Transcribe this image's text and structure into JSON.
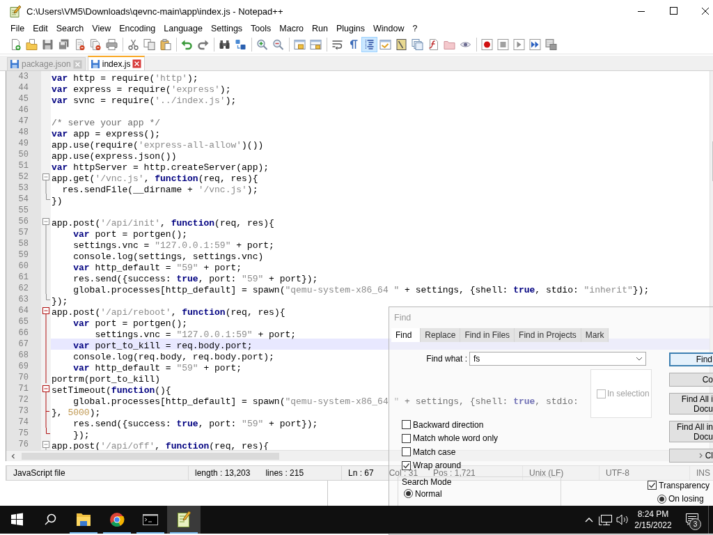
{
  "window": {
    "title": "C:\\Users\\VM5\\Downloads\\qevnc-main\\app\\index.js - Notepad++"
  },
  "menu": [
    "File",
    "Edit",
    "Search",
    "View",
    "Encoding",
    "Language",
    "Settings",
    "Tools",
    "Macro",
    "Run",
    "Plugins",
    "Window",
    "?"
  ],
  "toolbar": [
    [
      {
        "kind": "new",
        "pressed": false
      },
      {
        "kind": "open",
        "pressed": false
      },
      {
        "kind": "save",
        "pressed": false
      },
      {
        "kind": "save_all",
        "pressed": false
      },
      {
        "kind": "close",
        "pressed": false
      },
      {
        "kind": "close_all",
        "pressed": false
      },
      {
        "kind": "print",
        "pressed": false
      }
    ],
    [
      {
        "kind": "cut",
        "pressed": false
      },
      {
        "kind": "copy",
        "pressed": false
      },
      {
        "kind": "paste",
        "pressed": false
      }
    ],
    [
      {
        "kind": "undo",
        "pressed": false
      },
      {
        "kind": "redo",
        "pressed": false
      }
    ],
    [
      {
        "kind": "find",
        "pressed": false
      },
      {
        "kind": "replace",
        "pressed": false
      }
    ],
    [
      {
        "kind": "zoom_in",
        "pressed": false
      },
      {
        "kind": "zoom_out",
        "pressed": false
      }
    ],
    [
      {
        "kind": "sync_v",
        "pressed": false
      },
      {
        "kind": "sync_h",
        "pressed": false
      }
    ],
    [
      {
        "kind": "wrap",
        "pressed": false
      },
      {
        "kind": "all_chars",
        "pressed": false
      },
      {
        "kind": "indent_guide",
        "pressed": true
      },
      {
        "kind": "udl",
        "pressed": false
      },
      {
        "kind": "doc_map",
        "pressed": false
      },
      {
        "kind": "doc_list",
        "pressed": false
      },
      {
        "kind": "func_list",
        "pressed": false
      },
      {
        "kind": "workspace",
        "pressed": false
      },
      {
        "kind": "monitor",
        "pressed": false
      }
    ],
    [
      {
        "kind": "record",
        "pressed": false
      },
      {
        "kind": "stop",
        "pressed": false
      },
      {
        "kind": "play",
        "pressed": false
      },
      {
        "kind": "play_multi",
        "pressed": false
      },
      {
        "kind": "save_macro",
        "pressed": false
      }
    ]
  ],
  "tabs": [
    {
      "label": "package.json",
      "selected": false
    },
    {
      "label": "index.js",
      "selected": true
    }
  ],
  "editor": {
    "lines": [
      {
        "number": "43",
        "selected": false,
        "tokens": [
          {
            "kind": "keyword",
            "text": "var"
          },
          {
            "kind": "plain",
            "text": " http = require("
          },
          {
            "kind": "string",
            "text": "'http'"
          },
          {
            "kind": "plain",
            "text": ");"
          }
        ]
      },
      {
        "number": "44",
        "selected": false,
        "tokens": [
          {
            "kind": "keyword",
            "text": "var"
          },
          {
            "kind": "plain",
            "text": " express = require("
          },
          {
            "kind": "string",
            "text": "'express'"
          },
          {
            "kind": "plain",
            "text": ");"
          }
        ]
      },
      {
        "number": "45",
        "selected": false,
        "tokens": [
          {
            "kind": "keyword",
            "text": "var"
          },
          {
            "kind": "plain",
            "text": " svnc = require("
          },
          {
            "kind": "string",
            "text": "'../index.js'"
          },
          {
            "kind": "plain",
            "text": ");"
          }
        ]
      },
      {
        "number": "46",
        "selected": false
      },
      {
        "number": "47",
        "selected": false,
        "tokens": [
          {
            "kind": "comment",
            "text": "/* serve your app */"
          }
        ]
      },
      {
        "number": "48",
        "selected": false,
        "tokens": [
          {
            "kind": "keyword",
            "text": "var"
          },
          {
            "kind": "plain",
            "text": " app = express();"
          }
        ]
      },
      {
        "number": "49",
        "selected": false,
        "tokens": [
          {
            "kind": "plain",
            "text": "app.use(require("
          },
          {
            "kind": "string",
            "text": "'express-all-allow'"
          },
          {
            "kind": "plain",
            "text": ")())"
          }
        ]
      },
      {
        "number": "50",
        "selected": false,
        "tokens": [
          {
            "kind": "plain",
            "text": "app.use(express.json())"
          }
        ]
      },
      {
        "number": "51",
        "selected": false,
        "tokens": [
          {
            "kind": "keyword",
            "text": "var"
          },
          {
            "kind": "plain",
            "text": " httpServer = http.createServer(app);"
          }
        ]
      },
      {
        "number": "52",
        "fold": {
          "kind": "open",
          "highlight": false
        },
        "selected": false,
        "tokens": [
          {
            "kind": "plain",
            "text": "app.get("
          },
          {
            "kind": "string",
            "text": "'/vnc.js'"
          },
          {
            "kind": "plain",
            "text": ", "
          },
          {
            "kind": "keyword",
            "text": "function"
          },
          {
            "kind": "plain",
            "text": "(req, res){"
          }
        ]
      },
      {
        "number": "53",
        "fold": {
          "kind": "body",
          "highlight": false
        },
        "selected": false,
        "tokens": [
          {
            "kind": "plain",
            "text": "  res.sendFile(__dirname + "
          },
          {
            "kind": "string",
            "text": "'/vnc.js'"
          },
          {
            "kind": "plain",
            "text": ");"
          }
        ]
      },
      {
        "number": "54",
        "fold": {
          "kind": "close",
          "highlight": false
        },
        "selected": false,
        "tokens": [
          {
            "kind": "plain",
            "text": "})"
          }
        ]
      },
      {
        "number": "55",
        "selected": false
      },
      {
        "number": "56",
        "fold": {
          "kind": "open",
          "highlight": false
        },
        "selected": false,
        "tokens": [
          {
            "kind": "plain",
            "text": "app.post("
          },
          {
            "kind": "string",
            "text": "'/api/init'"
          },
          {
            "kind": "plain",
            "text": ", "
          },
          {
            "kind": "keyword",
            "text": "function"
          },
          {
            "kind": "plain",
            "text": "(req, res){"
          }
        ]
      },
      {
        "number": "57",
        "fold": {
          "kind": "body",
          "highlight": false
        },
        "selected": false,
        "tokens": [
          {
            "kind": "keyword",
            "text": "    var"
          },
          {
            "kind": "plain",
            "text": " port = portgen();"
          }
        ]
      },
      {
        "number": "58",
        "fold": {
          "kind": "body",
          "highlight": false
        },
        "selected": false,
        "tokens": [
          {
            "kind": "plain",
            "text": "    settings.vnc = "
          },
          {
            "kind": "string",
            "text": "\"127.0.0.1:59\""
          },
          {
            "kind": "plain",
            "text": " + port;"
          }
        ]
      },
      {
        "number": "59",
        "fold": {
          "kind": "body",
          "highlight": false
        },
        "selected": false,
        "tokens": [
          {
            "kind": "plain",
            "text": "    console.log(settings, settings.vnc)"
          }
        ]
      },
      {
        "number": "60",
        "fold": {
          "kind": "body",
          "highlight": false
        },
        "selected": false,
        "tokens": [
          {
            "kind": "keyword",
            "text": "    var"
          },
          {
            "kind": "plain",
            "text": " http_default = "
          },
          {
            "kind": "string",
            "text": "\"59\""
          },
          {
            "kind": "plain",
            "text": " + port;"
          }
        ]
      },
      {
        "number": "61",
        "fold": {
          "kind": "body",
          "highlight": false
        },
        "selected": false,
        "tokens": [
          {
            "kind": "plain",
            "text": "    res.send({success: "
          },
          {
            "kind": "keyword",
            "text": "true"
          },
          {
            "kind": "plain",
            "text": ", port: "
          },
          {
            "kind": "string",
            "text": "\"59\""
          },
          {
            "kind": "plain",
            "text": " + port});"
          }
        ]
      },
      {
        "number": "62",
        "fold": {
          "kind": "body",
          "highlight": false
        },
        "selected": false,
        "tokens": [
          {
            "kind": "plain",
            "text": "    global.processes[http_default] = spawn("
          },
          {
            "kind": "string",
            "text": "\"qemu-system-x86_64 \""
          },
          {
            "kind": "plain",
            "text": " + settings, {shell: "
          },
          {
            "kind": "keyword",
            "text": "true"
          },
          {
            "kind": "plain",
            "text": ", stdio: "
          },
          {
            "kind": "string",
            "text": "\"inherit\""
          },
          {
            "kind": "plain",
            "text": "});"
          }
        ]
      },
      {
        "number": "63",
        "fold": {
          "kind": "close",
          "highlight": false
        },
        "selected": false,
        "tokens": [
          {
            "kind": "plain",
            "text": "});"
          }
        ]
      },
      {
        "number": "64",
        "fold": {
          "kind": "open",
          "highlight": true
        },
        "selected": false,
        "tokens": [
          {
            "kind": "plain",
            "text": "app.post("
          },
          {
            "kind": "string",
            "text": "'/api/reboot'"
          },
          {
            "kind": "plain",
            "text": ", "
          },
          {
            "kind": "keyword",
            "text": "function"
          },
          {
            "kind": "plain",
            "text": "(req, res){"
          }
        ]
      },
      {
        "number": "65",
        "fold": {
          "kind": "body",
          "highlight": true
        },
        "selected": false,
        "tokens": [
          {
            "kind": "keyword",
            "text": "    var"
          },
          {
            "kind": "plain",
            "text": " port = portgen();"
          }
        ]
      },
      {
        "number": "66",
        "fold": {
          "kind": "body",
          "highlight": true
        },
        "selected": false,
        "tokens": [
          {
            "kind": "plain",
            "text": "        settings.vnc = "
          },
          {
            "kind": "string",
            "text": "\"127.0.0.1:59\""
          },
          {
            "kind": "plain",
            "text": " + port;"
          }
        ]
      },
      {
        "number": "67",
        "fold": {
          "kind": "body",
          "highlight": true
        },
        "selected": true,
        "tokens": [
          {
            "kind": "keyword",
            "text": "    var"
          },
          {
            "kind": "plain",
            "text": " port_to_kill = req.body.port;"
          }
        ]
      },
      {
        "number": "68",
        "fold": {
          "kind": "body",
          "highlight": true
        },
        "selected": false,
        "tokens": [
          {
            "kind": "plain",
            "text": "    console.log(req.body, req.body.port);"
          }
        ]
      },
      {
        "number": "69",
        "fold": {
          "kind": "body",
          "highlight": true
        },
        "selected": false,
        "tokens": [
          {
            "kind": "keyword",
            "text": "    var"
          },
          {
            "kind": "plain",
            "text": " http_default = "
          },
          {
            "kind": "string",
            "text": "\"59\""
          },
          {
            "kind": "plain",
            "text": " + port;"
          }
        ]
      },
      {
        "number": "70",
        "fold": {
          "kind": "body",
          "highlight": true
        },
        "selected": false,
        "tokens": [
          {
            "kind": "plain",
            "text": "portrm(port_to_kill)"
          }
        ]
      },
      {
        "number": "71",
        "fold": {
          "kind": "open",
          "highlight": true
        },
        "selected": false,
        "tokens": [
          {
            "kind": "plain",
            "text": "setTimeout("
          },
          {
            "kind": "keyword",
            "text": "function"
          },
          {
            "kind": "plain",
            "text": "(){"
          }
        ]
      },
      {
        "number": "72",
        "fold": {
          "kind": "body",
          "highlight": true
        },
        "selected": false,
        "tokens": [
          {
            "kind": "plain",
            "text": "    global.processes[http_default] = spawn("
          },
          {
            "kind": "string",
            "text": "\"qemu-system-x86_64 \""
          },
          {
            "kind": "plain",
            "text": " + settings, {shell: "
          },
          {
            "kind": "keyword",
            "text": "true"
          },
          {
            "kind": "plain",
            "text": ", stdio:"
          }
        ]
      },
      {
        "number": "73",
        "fold": {
          "kind": "branch",
          "highlight": true
        },
        "selected": false,
        "tokens": [
          {
            "kind": "plain",
            "text": "}, "
          },
          {
            "kind": "number",
            "text": "5000"
          },
          {
            "kind": "plain",
            "text": ");"
          }
        ]
      },
      {
        "number": "74",
        "fold": {
          "kind": "body",
          "highlight": true
        },
        "selected": false,
        "tokens": [
          {
            "kind": "plain",
            "text": "    res.send({success: "
          },
          {
            "kind": "keyword",
            "text": "true"
          },
          {
            "kind": "plain",
            "text": ", port: "
          },
          {
            "kind": "string",
            "text": "\"59\""
          },
          {
            "kind": "plain",
            "text": " + port});"
          }
        ]
      },
      {
        "number": "75",
        "fold": {
          "kind": "close",
          "highlight": true
        },
        "selected": false,
        "tokens": [
          {
            "kind": "plain",
            "text": "    });"
          }
        ]
      },
      {
        "number": "76",
        "fold": {
          "kind": "open",
          "highlight": false
        },
        "selected": false,
        "tokens": [
          {
            "kind": "plain",
            "text": "app.post("
          },
          {
            "kind": "string",
            "text": "'/api/off'"
          },
          {
            "kind": "plain",
            "text": ", "
          },
          {
            "kind": "keyword",
            "text": "function"
          },
          {
            "kind": "plain",
            "text": "(req, res){"
          }
        ]
      }
    ]
  },
  "status_bar": {
    "file_type": "JavaScript file",
    "length": "length : 13,203",
    "lines": "lines : 215",
    "ln": "Ln : 67",
    "col": "Col : 31",
    "pos": "Pos : 1,721",
    "eol": "Unix (LF)",
    "encoding": "UTF-8",
    "mode": "INS"
  },
  "find_dialog": {
    "title": "Find",
    "tabs": [
      {
        "label": "Find",
        "selected": true
      },
      {
        "label": "Replace",
        "selected": false
      },
      {
        "label": "Find in Files",
        "selected": false
      },
      {
        "label": "Find in Projects",
        "selected": false
      },
      {
        "label": "Mark",
        "selected": false
      }
    ],
    "find_what": {
      "label": "Find what :",
      "value": "fs"
    },
    "in_selection": {
      "label": "In selection",
      "checked": false,
      "disabled": true
    },
    "buttons": [
      {
        "kind": "plain",
        "lines": [
          "Find"
        ],
        "default": true
      },
      {
        "kind": "plain",
        "lines": [
          "Co"
        ],
        "default": false
      },
      {
        "kind": "plain",
        "lines": [
          "Find All i",
          "Docu"
        ],
        "default": false
      },
      {
        "kind": "plain",
        "lines": [
          "Find All in",
          "Docu"
        ],
        "default": false
      },
      {
        "kind": "more",
        "lines": [
          "Cl"
        ],
        "default": false
      }
    ],
    "options": [
      {
        "label": "Backward direction",
        "checked": false
      },
      {
        "label": "Match whole word only",
        "checked": false
      },
      {
        "label": "Match case",
        "checked": false
      },
      {
        "label": "Wrap around",
        "checked": true
      }
    ],
    "search_mode": {
      "title": "Search Mode",
      "options": [
        {
          "label": "Normal",
          "selected": true
        }
      ]
    },
    "transparency": {
      "label": "Transparency",
      "checked": true,
      "options": [
        {
          "label": "On losing",
          "selected": true
        }
      ]
    }
  },
  "taskbar": {
    "apps": [
      {
        "kind": "folder",
        "running": true,
        "active": false
      },
      {
        "kind": "browser",
        "running": true,
        "active": false
      },
      {
        "kind": "terminal",
        "running": true,
        "active": false
      },
      {
        "kind": "notepad",
        "running": true,
        "active": true
      }
    ],
    "time": "8:24 PM",
    "date": "2/15/2022",
    "notifications": "3"
  }
}
